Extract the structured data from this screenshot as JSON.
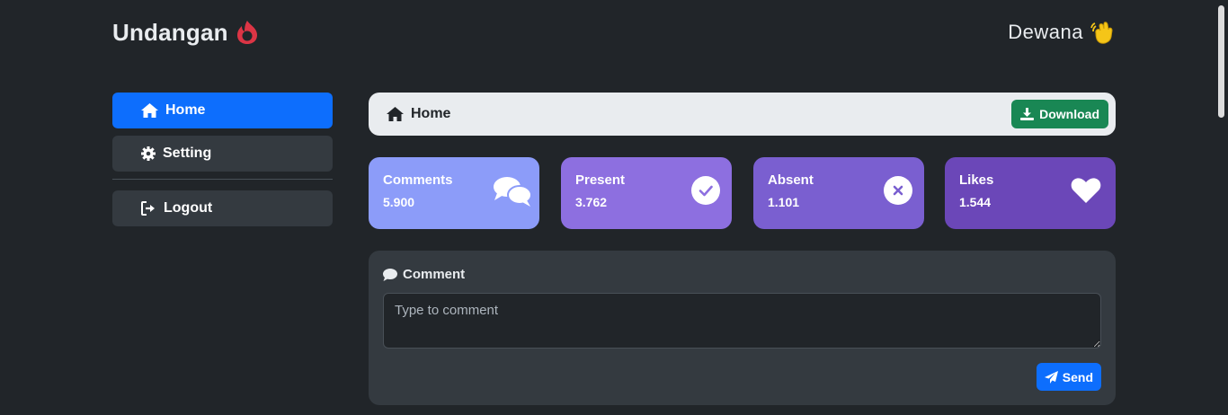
{
  "header": {
    "brand": "Undangan",
    "brand_icon": "fire-icon",
    "user_name": "Dewana",
    "user_icon": "waving-hand-icon"
  },
  "sidebar": {
    "items": [
      {
        "label": "Home",
        "icon": "home-icon",
        "active": true
      },
      {
        "label": "Setting",
        "icon": "gear-icon",
        "active": false
      }
    ],
    "logout": {
      "label": "Logout",
      "icon": "logout-icon"
    }
  },
  "breadcrumb": {
    "label": "Home",
    "icon": "home-icon",
    "download_label": "Download"
  },
  "stats": [
    {
      "title": "Comments",
      "value": "5.900",
      "icon": "comments-icon",
      "color": "#8c9cf9"
    },
    {
      "title": "Present",
      "value": "3.762",
      "icon": "check-circle-icon",
      "color": "#8d6fe0"
    },
    {
      "title": "Absent",
      "value": "1.101",
      "icon": "x-circle-icon",
      "color": "#7a5fd0"
    },
    {
      "title": "Likes",
      "value": "1.544",
      "icon": "heart-icon",
      "color": "#6b47b8"
    }
  ],
  "comment": {
    "title": "Comment",
    "placeholder": "Type to comment",
    "send_label": "Send"
  },
  "colors": {
    "background": "#212529",
    "primary": "#0d6efd",
    "success": "#198754",
    "panel": "#343a40"
  }
}
